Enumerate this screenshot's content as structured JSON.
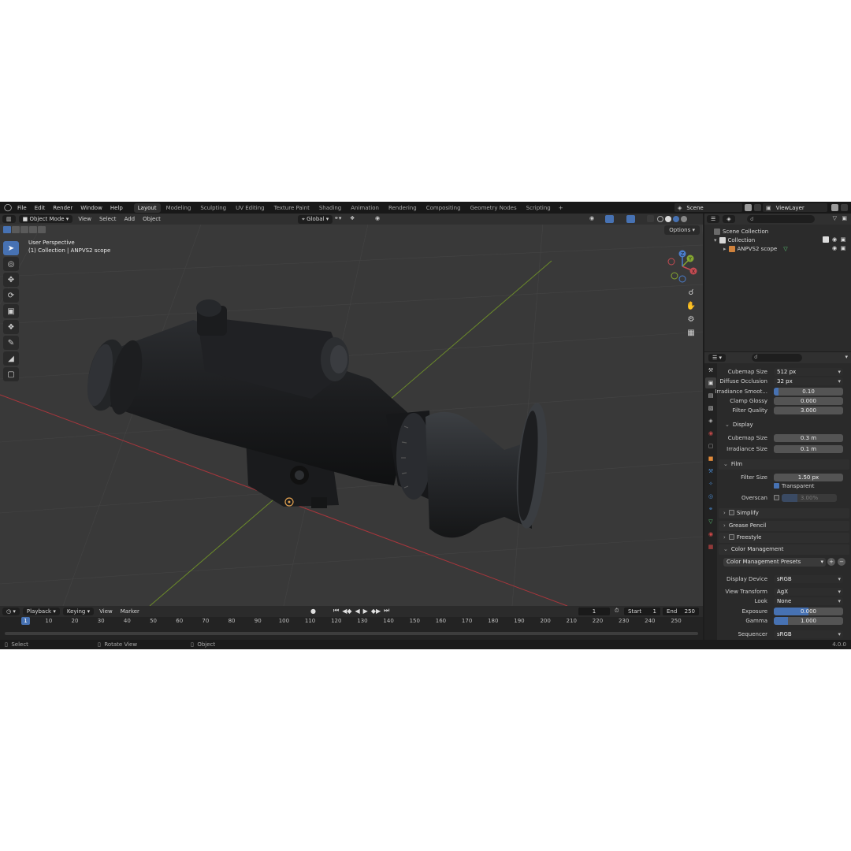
{
  "menu": {
    "items": [
      "File",
      "Edit",
      "Render",
      "Window",
      "Help"
    ],
    "workspaces": [
      "Layout",
      "Modeling",
      "Sculpting",
      "UV Editing",
      "Texture Paint",
      "Shading",
      "Animation",
      "Rendering",
      "Compositing",
      "Geometry Nodes",
      "Scripting"
    ],
    "active_workspace": "Layout",
    "plus": "+",
    "scene": "Scene",
    "view_layer": "ViewLayer"
  },
  "viewport": {
    "mode": "Object Mode",
    "menus": [
      "View",
      "Select",
      "Add",
      "Object"
    ],
    "transform_orientation": "Global",
    "options": "Options",
    "perspective_label": "User Perspective",
    "collection_label": "(1) Collection | ANPVS2 scope",
    "gizmo": {
      "x": "X",
      "y": "Y",
      "z": "Z"
    }
  },
  "timeline": {
    "menus": [
      "Playback",
      "Keying",
      "View",
      "Marker"
    ],
    "current_frame": "1",
    "start_label": "Start",
    "start": "1",
    "end_label": "End",
    "end": "250",
    "ticks": [
      "10",
      "20",
      "30",
      "40",
      "50",
      "60",
      "70",
      "80",
      "90",
      "100",
      "110",
      "120",
      "130",
      "140",
      "150",
      "160",
      "170",
      "180",
      "190",
      "200",
      "210",
      "220",
      "230",
      "240",
      "250"
    ],
    "playhead": "1"
  },
  "statusbar": {
    "select": "Select",
    "rotate": "Rotate View",
    "object": "Object",
    "version": "4.0.0"
  },
  "outliner": {
    "scene_collection": "Scene Collection",
    "collection": "Collection",
    "object": "ANPVS2 scope"
  },
  "properties": {
    "cubemap_size_label": "Cubemap Size",
    "cubemap_size": "512 px",
    "diffuse_occlusion_label": "Diffuse Occlusion",
    "diffuse_occlusion": "32 px",
    "irradiance_smooth_label": "Irradiance Smoot...",
    "irradiance_smooth": "0.10",
    "irradiance_smooth_fraction": 0.07,
    "clamp_glossy_label": "Clamp Glossy",
    "clamp_glossy": "0.000",
    "filter_quality_label": "Filter Quality",
    "filter_quality": "3.000",
    "display_section": "Display",
    "display_cubemap_label": "Cubemap Size",
    "display_cubemap": "0.3 m",
    "display_irradiance_label": "Irradiance Size",
    "display_irradiance": "0.1 m",
    "film_section": "Film",
    "filter_size_label": "Filter Size",
    "filter_size": "1.50 px",
    "transparent_label": "Transparent",
    "overscan_label": "Overscan",
    "overscan": "3.00%",
    "simplify_section": "Simplify",
    "grease_pencil_section": "Grease Pencil",
    "freestyle_section": "Freestyle",
    "color_management_section": "Color Management",
    "presets_label": "Color Management Presets",
    "display_device_label": "Display Device",
    "display_device": "sRGB",
    "view_transform_label": "View Transform",
    "view_transform": "AgX",
    "look_label": "Look",
    "look": "None",
    "exposure_label": "Exposure",
    "exposure": "0.000",
    "exposure_fraction": 0.5,
    "gamma_label": "Gamma",
    "gamma": "1.000",
    "gamma_fraction": 0.2,
    "sequencer_label": "Sequencer",
    "sequencer": "sRGB"
  },
  "colors": {
    "accent": "#4772b3",
    "x_axis": "#c44b52",
    "y_axis": "#84a531",
    "z_axis": "#4a7dcc",
    "viewport_bg": "#393939"
  }
}
